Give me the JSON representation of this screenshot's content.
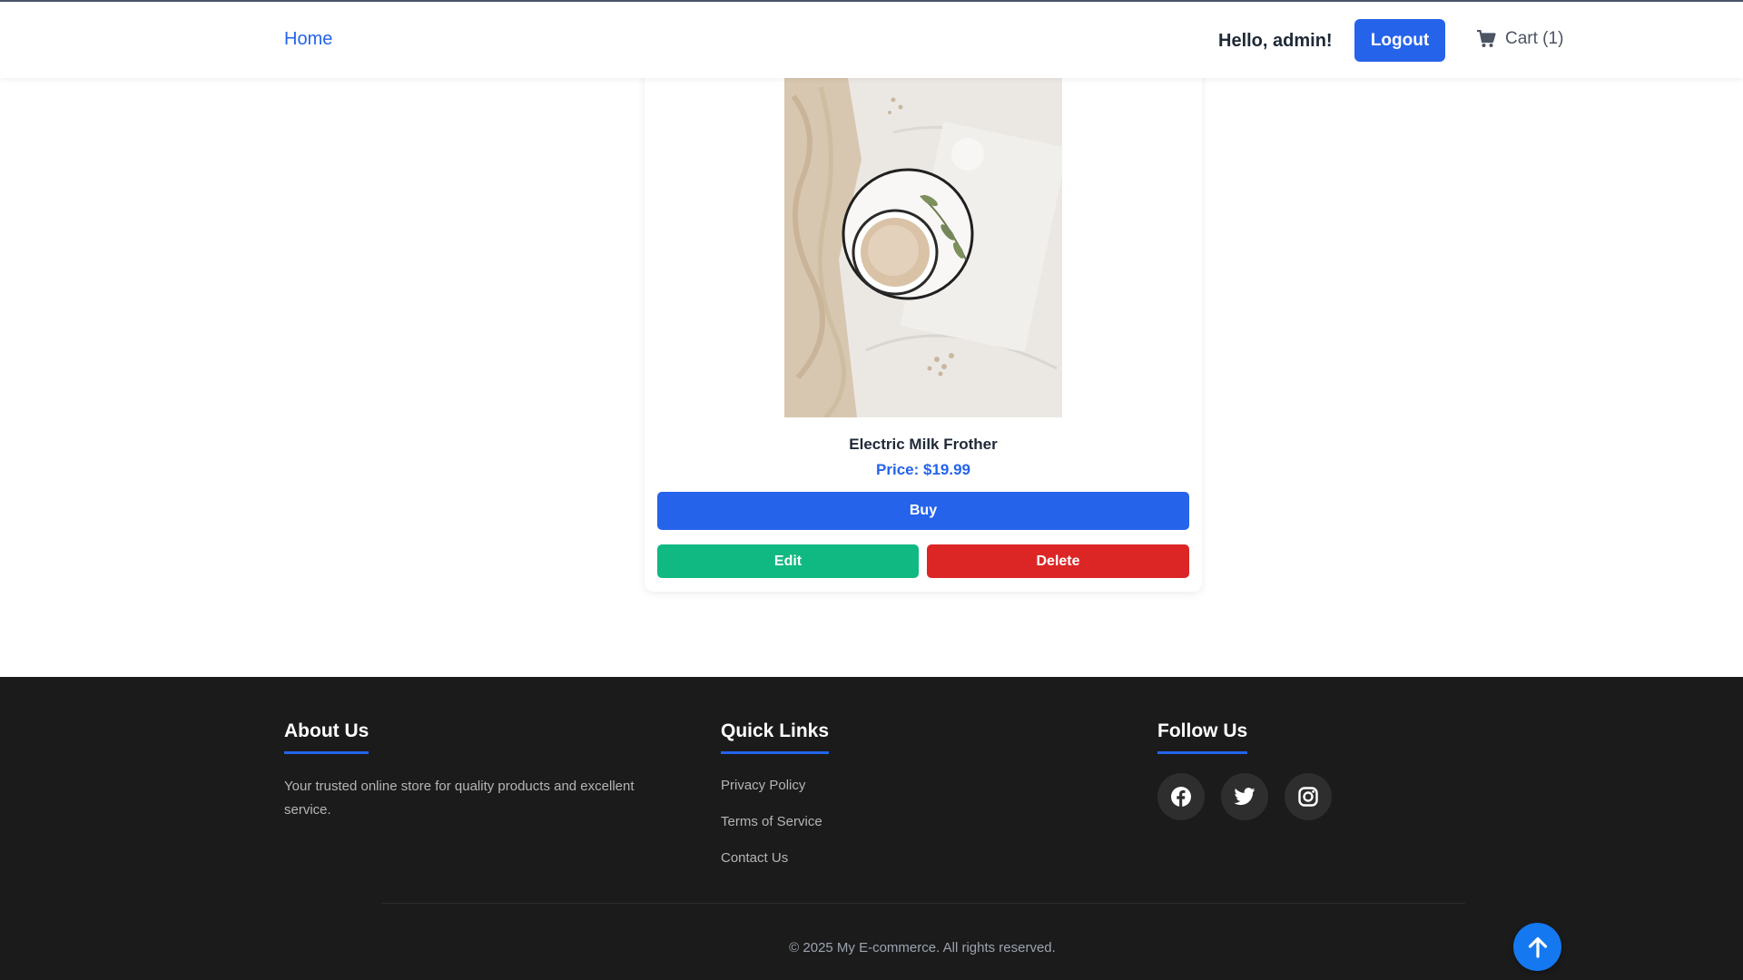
{
  "nav": {
    "home_label": "Home",
    "greeting": "Hello, admin!",
    "logout_label": "Logout",
    "cart_label": "Cart (1)",
    "cart_icon": "shopping-cart-icon"
  },
  "product": {
    "name": "Electric Milk Frother",
    "price": "Price: $19.99",
    "image_alt": "coffee-cup-on-tray-photo",
    "buy_label": "Buy",
    "edit_label": "Edit",
    "delete_label": "Delete"
  },
  "footer": {
    "about": {
      "title": "About Us",
      "text": "Your trusted online store for quality products and excellent service."
    },
    "quick_links": {
      "title": "Quick Links",
      "items": [
        "Privacy Policy",
        "Terms of Service",
        "Contact Us"
      ]
    },
    "follow": {
      "title": "Follow Us",
      "icons": [
        "facebook-icon",
        "twitter-icon",
        "instagram-icon"
      ]
    },
    "copyright": "© 2025 My E-commerce. All rights reserved."
  },
  "colors": {
    "primary": "#2563eb",
    "success": "#10b981",
    "danger": "#dc2626",
    "footer_bg": "#1b1b1b",
    "scroll_button": "#1478f0"
  }
}
